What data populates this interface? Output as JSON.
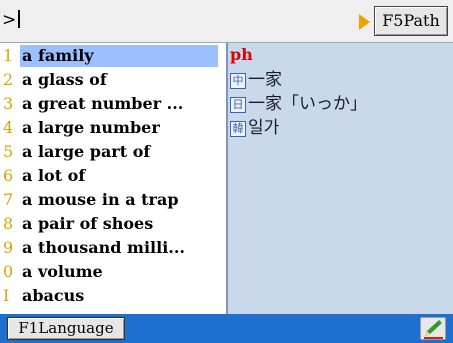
{
  "topbar": {
    "prompt": ">",
    "path_button": "F5Path"
  },
  "word_list": [
    {
      "num": "1",
      "word": "a family",
      "selected": true
    },
    {
      "num": "2",
      "word": "a glass of"
    },
    {
      "num": "3",
      "word": "a great number ..."
    },
    {
      "num": "4",
      "word": "a large number"
    },
    {
      "num": "5",
      "word": "a large part of"
    },
    {
      "num": "6",
      "word": "a lot of"
    },
    {
      "num": "7",
      "word": "a mouse in a trap"
    },
    {
      "num": "8",
      "word": "a pair of shoes"
    },
    {
      "num": "9",
      "word": "a thousand milli..."
    },
    {
      "num": "0",
      "word": "a volume"
    },
    {
      "num": "I",
      "word": "abacus"
    }
  ],
  "detail": {
    "headword": "ph",
    "definitions": [
      {
        "tag": "中",
        "text": "一家"
      },
      {
        "tag": "日",
        "text": "一家「いっか」"
      },
      {
        "tag": "韓",
        "text": "일가"
      }
    ]
  },
  "bottombar": {
    "language_button": "F1Language",
    "icon": "pen-icon"
  },
  "colors": {
    "selection": "#9cc0ff",
    "number": "#e0a000",
    "detail_bg": "#c9d9ec",
    "headword": "#e00000",
    "bottombar": "#1f6fd0"
  }
}
